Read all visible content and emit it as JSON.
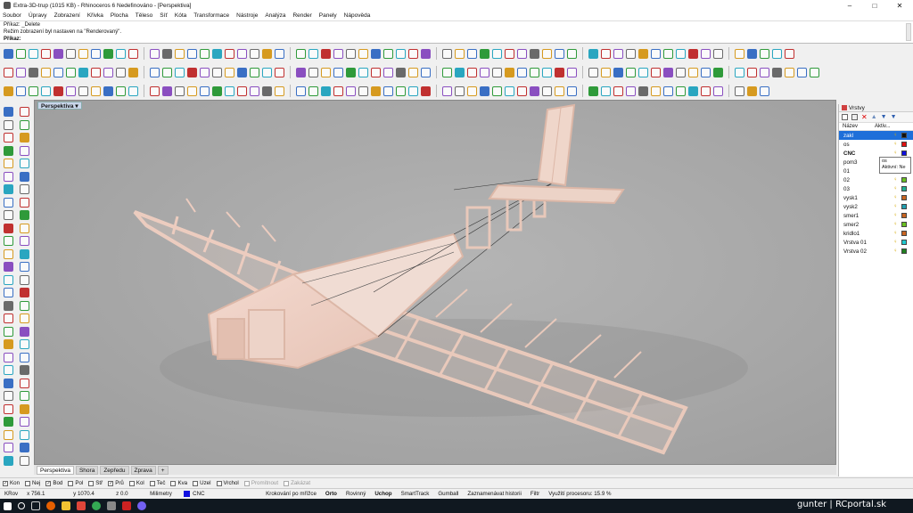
{
  "window": {
    "title": "Extra-3D-trup (1015 KB) - Rhinoceros 6 Nedefinováno - [Perspektiva]",
    "controls": [
      "–",
      "□",
      "✕"
    ]
  },
  "menu": [
    "Soubor",
    "Úpravy",
    "Zobrazení",
    "Křivka",
    "Plocha",
    "Těleso",
    "Síť",
    "Kóta",
    "Transformace",
    "Nástroje",
    "Analýza",
    "Render",
    "Panely",
    "Nápověda"
  ],
  "command": {
    "history1": "Příkaz: _Delete",
    "history2": "Režim zobrazení byl nastaven na \"Renderovaný\".",
    "prompt": "Příkaz:"
  },
  "viewport": {
    "label": "Perspektiva",
    "tabs": [
      "Perspektiva",
      "Shora",
      "Zepředu",
      "Zprava"
    ],
    "add_tab": "+"
  },
  "layers_panel": {
    "title": "Vrstvy",
    "col_name": "Název",
    "col_active": "Aktiv...",
    "layers": [
      {
        "name": "zakl",
        "color": "#111111",
        "selected": true,
        "bold": false
      },
      {
        "name": "os",
        "color": "#e01010",
        "selected": false,
        "bold": false
      },
      {
        "name": "CNC",
        "color": "#1010e0",
        "selected": false,
        "bold": true
      },
      {
        "name": "pom3",
        "color": "#333333",
        "selected": false,
        "bold": false
      },
      {
        "name": "01",
        "color": "#c86420",
        "selected": false,
        "bold": false
      },
      {
        "name": "02",
        "color": "#6ac020",
        "selected": false,
        "bold": false
      },
      {
        "name": "03",
        "color": "#20b090",
        "selected": false,
        "bold": false
      },
      {
        "name": "vysk1",
        "color": "#c86420",
        "selected": false,
        "bold": false
      },
      {
        "name": "vysk2",
        "color": "#20a0b0",
        "selected": false,
        "bold": false
      },
      {
        "name": "smer1",
        "color": "#c86420",
        "selected": false,
        "bold": false
      },
      {
        "name": "smer2",
        "color": "#6ac020",
        "selected": false,
        "bold": false
      },
      {
        "name": "kridlo1",
        "color": "#c86420",
        "selected": false,
        "bold": false
      },
      {
        "name": "Vrstva 01",
        "color": "#20c8d0",
        "selected": false,
        "bold": false
      },
      {
        "name": "Vrstva 02",
        "color": "#208020",
        "selected": false,
        "bold": false
      }
    ],
    "tooltip_line1": "os",
    "tooltip_line2": "Aktivní: Ne"
  },
  "osnap": [
    {
      "label": "Kon",
      "checked": true,
      "disabled": false
    },
    {
      "label": "Nej",
      "checked": false,
      "disabled": false
    },
    {
      "label": "Bod",
      "checked": true,
      "disabled": false
    },
    {
      "label": "Pol",
      "checked": false,
      "disabled": false
    },
    {
      "label": "Stř",
      "checked": false,
      "disabled": false
    },
    {
      "label": "Prů",
      "checked": true,
      "disabled": false
    },
    {
      "label": "Kol",
      "checked": false,
      "disabled": false
    },
    {
      "label": "Teč",
      "checked": false,
      "disabled": false
    },
    {
      "label": "Kva",
      "checked": false,
      "disabled": false
    },
    {
      "label": "Uzel",
      "checked": false,
      "disabled": false
    },
    {
      "label": "Vrchol",
      "checked": false,
      "disabled": false
    },
    {
      "label": "Promítnout",
      "checked": false,
      "disabled": true
    },
    {
      "label": "Zakázat",
      "checked": false,
      "disabled": true
    }
  ],
  "status": {
    "cplane": "KRov",
    "x": "x 756.1",
    "y": "y 1070.4",
    "z": "z 0.0",
    "units": "Milimetry",
    "layer": "CNC",
    "layer_color": "#1010e0",
    "grid_snap": "Krokování po mřížce",
    "ortho": "Orto",
    "planar": "Rovinný",
    "osnap": "Uchop",
    "smarttrack": "SmartTrack",
    "gumball": "Gumball",
    "history": "Zaznamenávat historii",
    "filter": "Filtr",
    "cpu": "Využití procesoru: 15.9 %"
  },
  "watermark": "gunter | RCportal.sk",
  "toolbar_colors": [
    "#3a6fc4",
    "#6a6a6a",
    "#c03030",
    "#2f9a3a",
    "#d69a20",
    "#8a4fc0",
    "#2aa6c0"
  ]
}
